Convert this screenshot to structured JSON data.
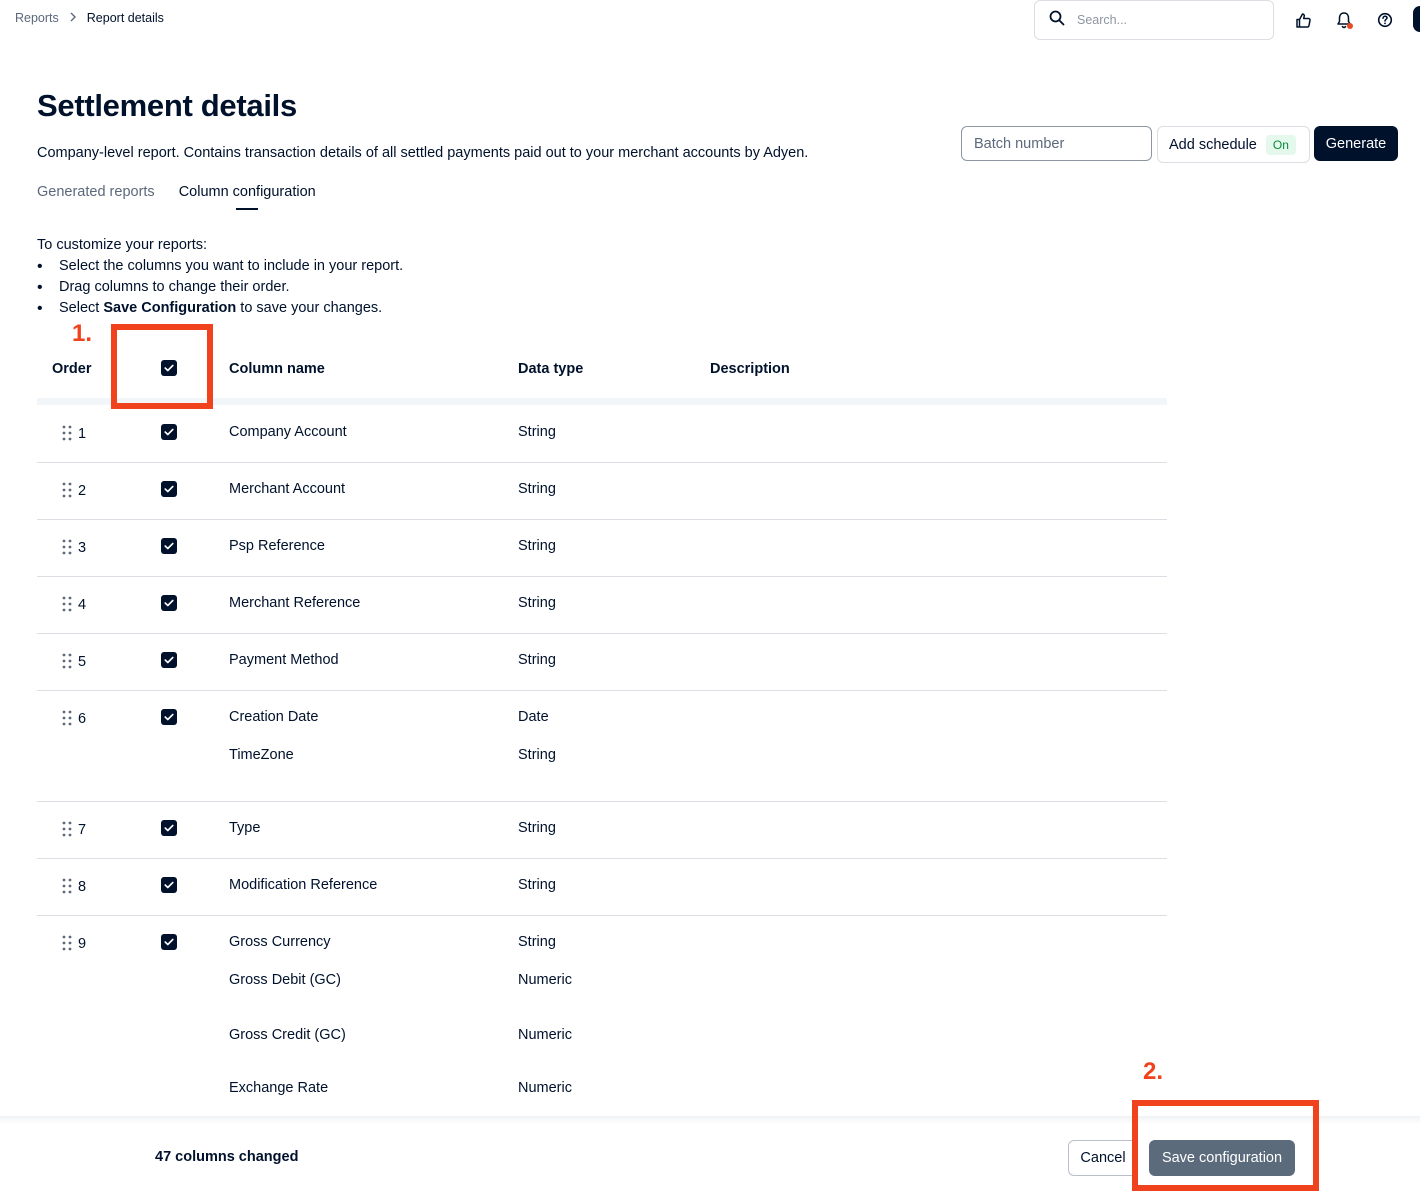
{
  "breadcrumb": {
    "parent": "Reports",
    "current": "Report details"
  },
  "topbar": {
    "search_placeholder": "Search...",
    "icons": [
      "search-icon",
      "thumbs-up-icon",
      "bell-icon",
      "help-icon",
      "avatar"
    ]
  },
  "header": {
    "title": "Settlement details",
    "description": "Company-level report. Contains transaction details of all settled payments paid out to your merchant accounts by Adyen.",
    "batch_placeholder": "Batch number",
    "schedule_label": "Add schedule",
    "schedule_status": "On",
    "generate_label": "Generate"
  },
  "tabs": [
    {
      "label": "Generated reports",
      "active": false
    },
    {
      "label": "Column configuration",
      "active": true
    }
  ],
  "instructions": {
    "intro": "To customize your reports:",
    "item1": "Select the columns you want to include in your report.",
    "item2": "Drag columns to change their order.",
    "item3_prefix": "Select ",
    "item3_bold": "Save Configuration",
    "item3_suffix": " to save your changes."
  },
  "table": {
    "headers": {
      "order": "Order",
      "column_name": "Column name",
      "data_type": "Data type",
      "description": "Description"
    },
    "rows": [
      {
        "order": "1",
        "checked": true,
        "name": "Company Account",
        "type": "String"
      },
      {
        "order": "2",
        "checked": true,
        "name": "Merchant Account",
        "type": "String"
      },
      {
        "order": "3",
        "checked": true,
        "name": "Psp Reference",
        "type": "String"
      },
      {
        "order": "4",
        "checked": true,
        "name": "Merchant Reference",
        "type": "String"
      },
      {
        "order": "5",
        "checked": true,
        "name": "Payment Method",
        "type": "String"
      },
      {
        "order": "6",
        "checked": true,
        "name": "Creation Date",
        "type": "Date",
        "subrows": [
          {
            "name": "TimeZone",
            "type": "String"
          }
        ]
      },
      {
        "order": "7",
        "checked": true,
        "name": "Type",
        "type": "String"
      },
      {
        "order": "8",
        "checked": true,
        "name": "Modification Reference",
        "type": "String"
      },
      {
        "order": "9",
        "checked": true,
        "name": "Gross Currency",
        "type": "String",
        "subrows": [
          {
            "name": "Gross Debit (GC)",
            "type": "Numeric"
          },
          {
            "name": "Gross Credit (GC)",
            "type": "Numeric"
          },
          {
            "name": "Exchange Rate",
            "type": "Numeric"
          }
        ]
      }
    ]
  },
  "annotations": {
    "step1": "1.",
    "step2": "2.",
    "color": "#f0421c"
  },
  "footer": {
    "changed_text": "47 columns changed",
    "cancel_label": "Cancel",
    "save_label": "Save configuration"
  },
  "colors": {
    "primary": "#00112c",
    "muted": "#5c687c",
    "save_button": "#5c6b7c",
    "badge_bg": "#e5f8ec",
    "badge_text": "#0a8a3f",
    "notification_dot": "#e94b26"
  }
}
